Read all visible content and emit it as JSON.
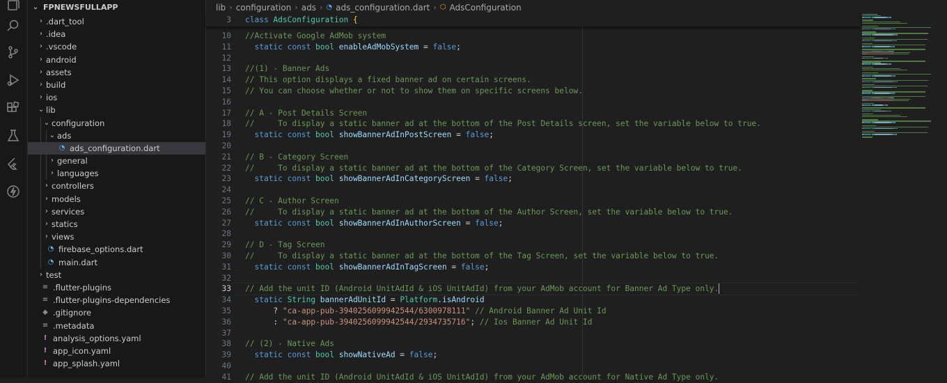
{
  "activity_bar": {
    "icons": [
      "explorer-icon",
      "search-icon",
      "source-control-icon",
      "run-debug-icon",
      "extensions-icon",
      "testing-icon",
      "flutter-icon",
      "bolt-icon"
    ]
  },
  "explorer": {
    "root": "FPNEWSFULLAPP",
    "items": [
      {
        "label": ".dart_tool",
        "kind": "folder",
        "depth": 1,
        "open": false
      },
      {
        "label": ".idea",
        "kind": "folder",
        "depth": 1,
        "open": false
      },
      {
        "label": ".vscode",
        "kind": "folder",
        "depth": 1,
        "open": false
      },
      {
        "label": "android",
        "kind": "folder",
        "depth": 1,
        "open": false
      },
      {
        "label": "assets",
        "kind": "folder",
        "depth": 1,
        "open": false
      },
      {
        "label": "build",
        "kind": "folder",
        "depth": 1,
        "open": false
      },
      {
        "label": "ios",
        "kind": "folder",
        "depth": 1,
        "open": false
      },
      {
        "label": "lib",
        "kind": "folder",
        "depth": 1,
        "open": true
      },
      {
        "label": "configuration",
        "kind": "folder",
        "depth": 2,
        "open": true
      },
      {
        "label": "ads",
        "kind": "folder",
        "depth": 3,
        "open": true
      },
      {
        "label": "ads_configuration.dart",
        "kind": "dart",
        "depth": 4,
        "selected": true
      },
      {
        "label": "general",
        "kind": "folder",
        "depth": 3,
        "open": false
      },
      {
        "label": "languages",
        "kind": "folder",
        "depth": 3,
        "open": false
      },
      {
        "label": "controllers",
        "kind": "folder",
        "depth": 2,
        "open": false
      },
      {
        "label": "models",
        "kind": "folder",
        "depth": 2,
        "open": false
      },
      {
        "label": "services",
        "kind": "folder",
        "depth": 2,
        "open": false
      },
      {
        "label": "statics",
        "kind": "folder",
        "depth": 2,
        "open": false
      },
      {
        "label": "views",
        "kind": "folder",
        "depth": 2,
        "open": false
      },
      {
        "label": "firebase_options.dart",
        "kind": "dart",
        "depth": 2
      },
      {
        "label": "main.dart",
        "kind": "dart",
        "depth": 2
      },
      {
        "label": "test",
        "kind": "folder",
        "depth": 1,
        "open": false
      },
      {
        "label": ".flutter-plugins",
        "kind": "lines",
        "depth": 1
      },
      {
        "label": ".flutter-plugins-dependencies",
        "kind": "lines",
        "depth": 1
      },
      {
        "label": ".gitignore",
        "kind": "dot",
        "depth": 1
      },
      {
        "label": ".metadata",
        "kind": "lines",
        "depth": 1
      },
      {
        "label": "analysis_options.yaml",
        "kind": "excl",
        "depth": 1
      },
      {
        "label": "app_icon.yaml",
        "kind": "excl",
        "depth": 1
      },
      {
        "label": "app_splash.yaml",
        "kind": "excl",
        "depth": 1
      }
    ]
  },
  "breadcrumb": [
    "lib",
    "configuration",
    "ads",
    "ads_configuration.dart",
    "AdsConfiguration"
  ],
  "sticky_line": {
    "num": "3",
    "tokens": [
      [
        "kw",
        "class "
      ],
      [
        "cls",
        "AdsConfiguration"
      ],
      [
        "op",
        " "
      ],
      [
        "pun",
        "{"
      ]
    ]
  },
  "current_line": "33",
  "code_lines": [
    {
      "num": "10",
      "tokens": [
        [
          "cm",
          "//Activate Google AdMob system"
        ]
      ]
    },
    {
      "num": "11",
      "tokens": [
        [
          "op",
          "  "
        ],
        [
          "kw",
          "static const "
        ],
        [
          "ty",
          "bool "
        ],
        [
          "id",
          "enableAdMobSystem"
        ],
        [
          "op",
          " = "
        ],
        [
          "kw",
          "false"
        ],
        [
          "op",
          ";"
        ]
      ]
    },
    {
      "num": "12",
      "tokens": []
    },
    {
      "num": "13",
      "tokens": [
        [
          "cm",
          "//(1) - Banner Ads"
        ]
      ]
    },
    {
      "num": "14",
      "tokens": [
        [
          "cm",
          "// This option displays a fixed banner ad on certain screens."
        ]
      ]
    },
    {
      "num": "15",
      "tokens": [
        [
          "cm",
          "// You can choose whether or not to show them on specific screens below."
        ]
      ]
    },
    {
      "num": "16",
      "tokens": []
    },
    {
      "num": "17",
      "tokens": [
        [
          "cm",
          "// A - Post Details Screen"
        ]
      ]
    },
    {
      "num": "18",
      "tokens": [
        [
          "cm",
          "//     To display a static banner ad at the bottom of the Post Details screen, set the variable below to true."
        ]
      ]
    },
    {
      "num": "19",
      "tokens": [
        [
          "op",
          "  "
        ],
        [
          "kw",
          "static const "
        ],
        [
          "ty",
          "bool "
        ],
        [
          "id",
          "showBannerAdInPostScreen"
        ],
        [
          "op",
          " = "
        ],
        [
          "kw",
          "false"
        ],
        [
          "op",
          ";"
        ]
      ]
    },
    {
      "num": "20",
      "tokens": []
    },
    {
      "num": "21",
      "tokens": [
        [
          "cm",
          "// B - Category Screen"
        ]
      ]
    },
    {
      "num": "22",
      "tokens": [
        [
          "cm",
          "//     To display a static banner ad at the bottom of the Category Screen, set the variable below to true."
        ]
      ]
    },
    {
      "num": "23",
      "tokens": [
        [
          "op",
          "  "
        ],
        [
          "kw",
          "static const "
        ],
        [
          "ty",
          "bool "
        ],
        [
          "id",
          "showBannerAdInCategoryScreen"
        ],
        [
          "op",
          " = "
        ],
        [
          "kw",
          "false"
        ],
        [
          "op",
          ";"
        ]
      ]
    },
    {
      "num": "24",
      "tokens": []
    },
    {
      "num": "25",
      "tokens": [
        [
          "cm",
          "// C - Author Screen"
        ]
      ]
    },
    {
      "num": "26",
      "tokens": [
        [
          "cm",
          "//     To display a static banner ad at the bottom of the Author Screen, set the variable below to true."
        ]
      ]
    },
    {
      "num": "27",
      "tokens": [
        [
          "op",
          "  "
        ],
        [
          "kw",
          "static const "
        ],
        [
          "ty",
          "bool "
        ],
        [
          "id",
          "showBannerAdInAuthorScreen"
        ],
        [
          "op",
          " = "
        ],
        [
          "kw",
          "false"
        ],
        [
          "op",
          ";"
        ]
      ]
    },
    {
      "num": "28",
      "tokens": []
    },
    {
      "num": "29",
      "tokens": [
        [
          "cm",
          "// D - Tag Screen"
        ]
      ]
    },
    {
      "num": "30",
      "tokens": [
        [
          "cm",
          "//     To display a static banner ad at the bottom of the Tag Screen, set the variable below to true."
        ]
      ]
    },
    {
      "num": "31",
      "tokens": [
        [
          "op",
          "  "
        ],
        [
          "kw",
          "static const "
        ],
        [
          "ty",
          "bool "
        ],
        [
          "id",
          "showBannerAdInTagScreen"
        ],
        [
          "op",
          " = "
        ],
        [
          "kw",
          "false"
        ],
        [
          "op",
          ";"
        ]
      ]
    },
    {
      "num": "32",
      "tokens": []
    },
    {
      "num": "33",
      "tokens": [
        [
          "cm",
          "// Add the unit ID (Android UnitAdId & iOS UnitAdId) from your AdMob account for Banner Ad Type only."
        ]
      ]
    },
    {
      "num": "34",
      "tokens": [
        [
          "op",
          "  "
        ],
        [
          "kw",
          "static "
        ],
        [
          "ty",
          "String "
        ],
        [
          "id",
          "bannerAdUnitId"
        ],
        [
          "op",
          " = "
        ],
        [
          "ty",
          "Platform"
        ],
        [
          "op",
          "."
        ],
        [
          "id",
          "isAndroid"
        ]
      ]
    },
    {
      "num": "35",
      "tokens": [
        [
          "op",
          "      ? "
        ],
        [
          "st",
          "\"ca-app-pub-3940256099942544/6300978111\""
        ],
        [
          "op",
          " "
        ],
        [
          "cm",
          "// Android Banner Ad Unit Id"
        ]
      ]
    },
    {
      "num": "36",
      "tokens": [
        [
          "op",
          "      : "
        ],
        [
          "st",
          "\"ca-app-pub-3940256099942544/2934735716\""
        ],
        [
          "op",
          "; "
        ],
        [
          "cm",
          "// Ios Banner Ad Unit Id"
        ]
      ]
    },
    {
      "num": "37",
      "tokens": []
    },
    {
      "num": "38",
      "tokens": [
        [
          "cm",
          "// (2) - Native Ads"
        ]
      ]
    },
    {
      "num": "39",
      "tokens": [
        [
          "op",
          "  "
        ],
        [
          "kw",
          "static const "
        ],
        [
          "ty",
          "bool "
        ],
        [
          "id",
          "showNativeAd"
        ],
        [
          "op",
          " = "
        ],
        [
          "kw",
          "false"
        ],
        [
          "op",
          ";"
        ]
      ]
    },
    {
      "num": "40",
      "tokens": []
    },
    {
      "num": "41",
      "tokens": [
        [
          "cm",
          "// Add the unit ID (Android UnitAdId & iOS UnitAdId) from your AdMob account for Native Ad Type only."
        ]
      ]
    }
  ]
}
